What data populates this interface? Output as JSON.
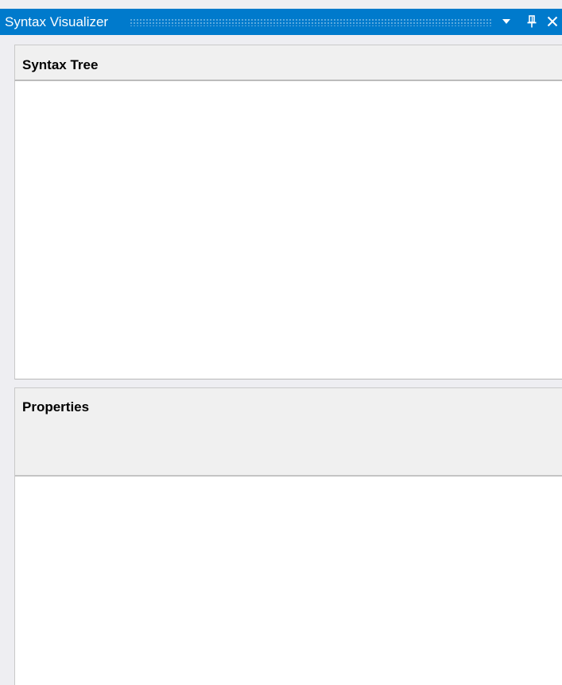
{
  "window": {
    "title": "Syntax Visualizer",
    "accent_color": "#007acc",
    "buttons": {
      "dropdown_icon": "chevron-down-icon",
      "pin_icon": "pin-icon",
      "close_icon": "close-icon"
    }
  },
  "syntax_tree": {
    "header": "Syntax Tree",
    "items": []
  },
  "properties": {
    "header": "Properties",
    "items": []
  }
}
